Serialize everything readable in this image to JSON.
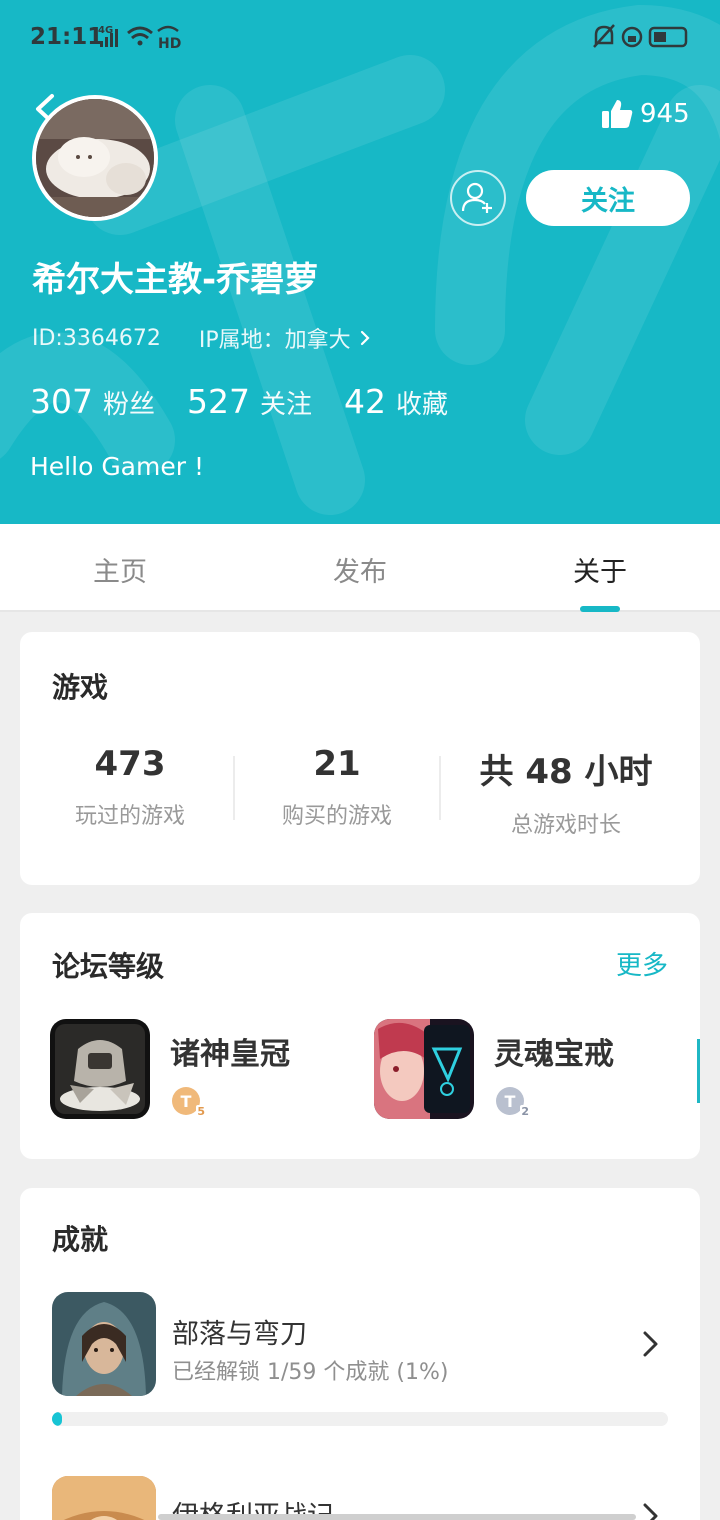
{
  "status_bar": {
    "time": "21:11",
    "network": "4G",
    "hd": "HD"
  },
  "profile": {
    "likes": "945",
    "follow_label": "关注",
    "name": "希尔大主教-乔碧萝",
    "id": "ID:3364672",
    "ip_location": "IP属地：加拿大",
    "bio": "Hello Gamer !",
    "stats": [
      {
        "value": "307",
        "label": "粉丝"
      },
      {
        "value": "527",
        "label": "关注"
      },
      {
        "value": "42",
        "label": "收藏"
      }
    ]
  },
  "tabs": [
    {
      "label": "主页",
      "active": false
    },
    {
      "label": "发布",
      "active": false
    },
    {
      "label": "关于",
      "active": true
    }
  ],
  "games_card": {
    "title": "游戏",
    "stats": [
      {
        "value": "473",
        "label": "玩过的游戏"
      },
      {
        "value": "21",
        "label": "购买的游戏"
      },
      {
        "value": "共 48 小时",
        "label": "总游戏时长"
      }
    ]
  },
  "forum_card": {
    "title": "论坛等级",
    "more_label": "更多",
    "items": [
      {
        "name": "诸神皇冠",
        "badge_letter": "T",
        "badge_level": "5",
        "badge_color": "#f0b97a"
      },
      {
        "name": "灵魂宝戒",
        "badge_letter": "T",
        "badge_level": "2",
        "badge_color": "#b9c0cf"
      }
    ]
  },
  "achievements_card": {
    "title": "成就",
    "items": [
      {
        "name": "部落与弯刀",
        "progress_text": "已经解锁 1/59 个成就 (1%)",
        "progress": 0.017
      },
      {
        "name": "伊格利亚战记",
        "progress_text": "",
        "progress": 0
      }
    ]
  },
  "colors": {
    "accent": "#17b8c6"
  }
}
